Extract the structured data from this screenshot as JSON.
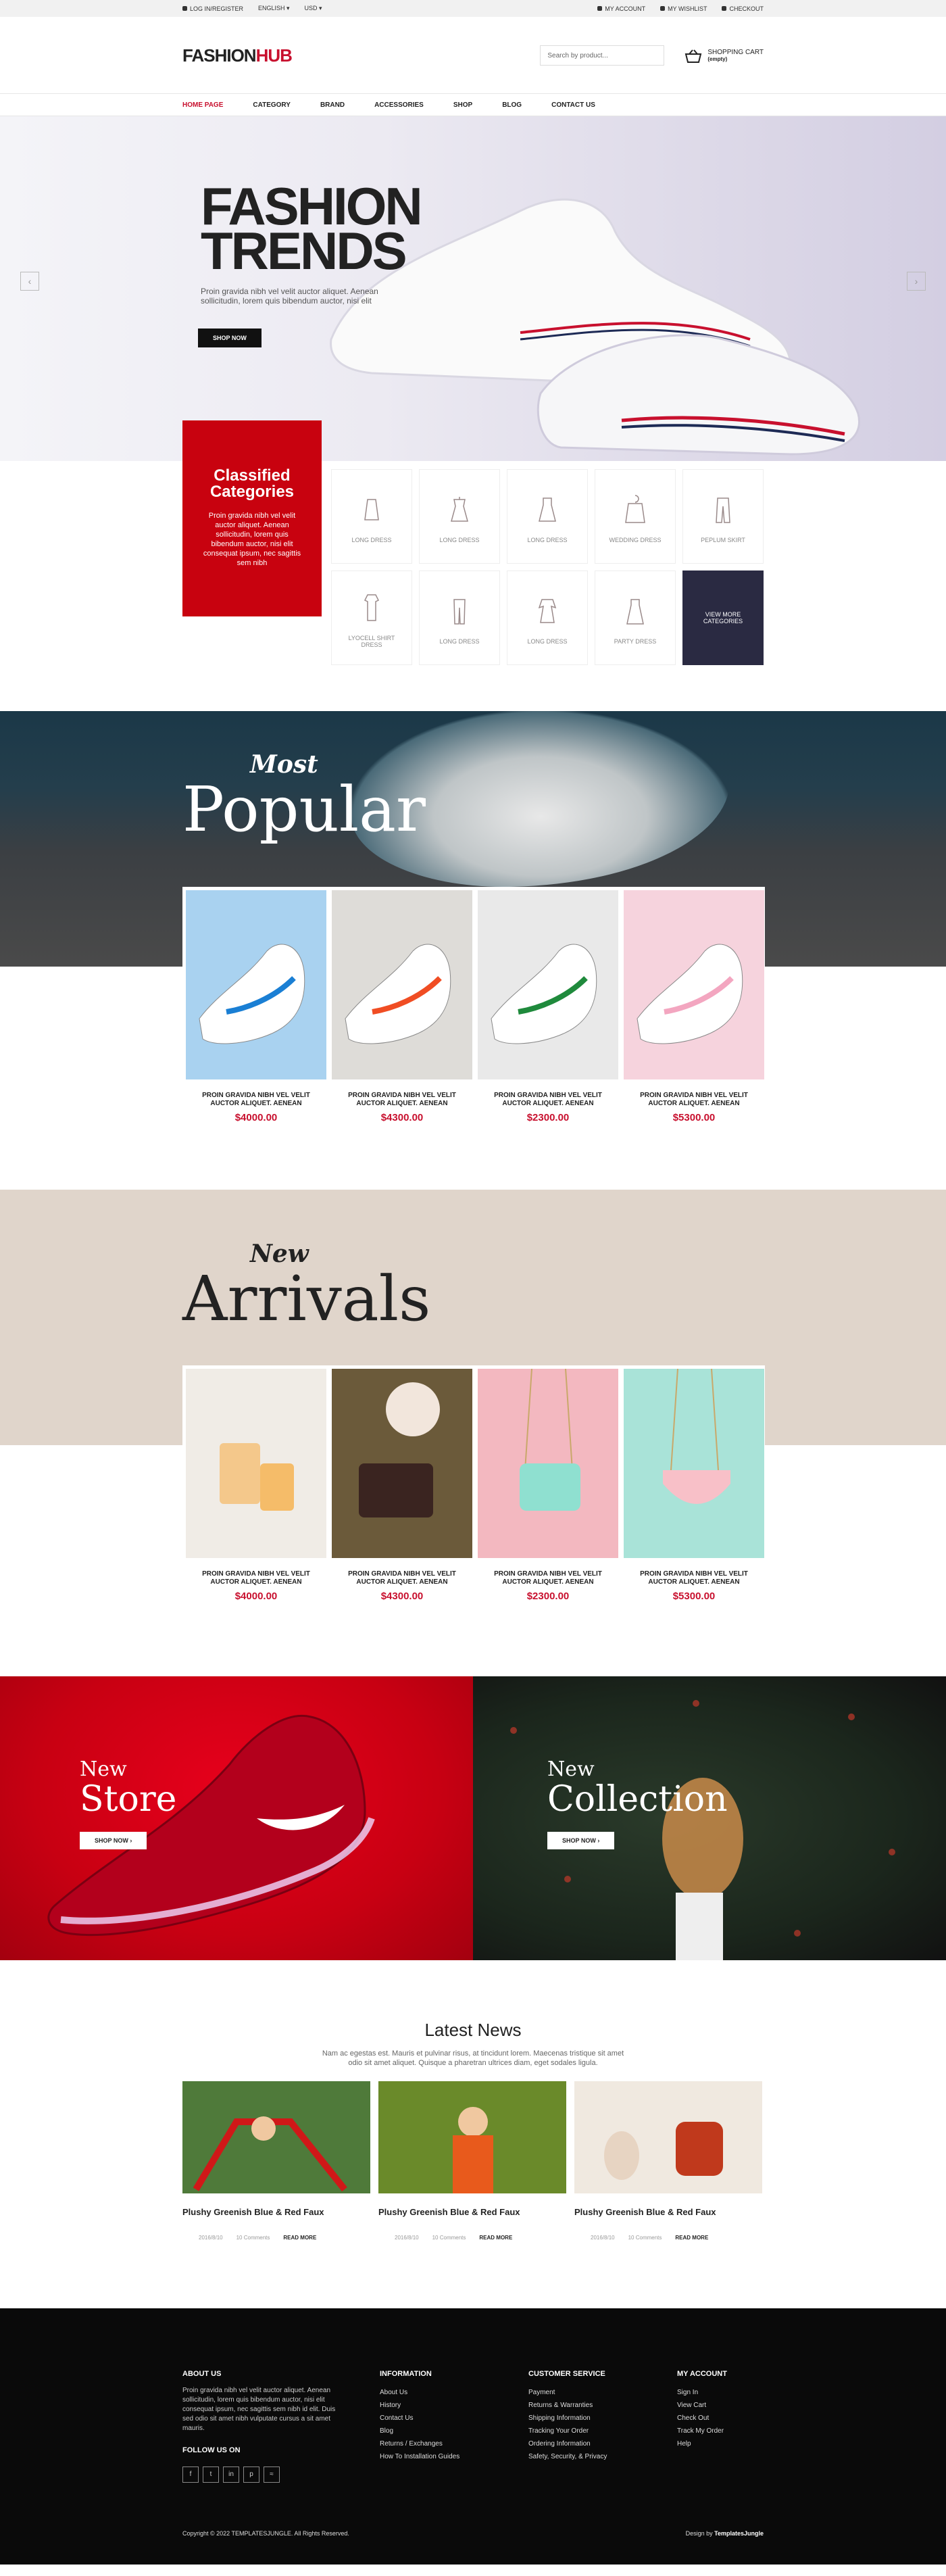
{
  "topbar": {
    "login": "LOG IN/REGISTER",
    "lang": "ENGLISH ▾",
    "currency": "USD ▾",
    "account": "MY ACCOUNT",
    "wishlist": "MY WISHLIST",
    "checkout": "CHECKOUT"
  },
  "header": {
    "logo_a": "FASHION",
    "logo_b": "HUB",
    "search_placeholder": "Search by product...",
    "cart_title": "SHOPPING CART",
    "cart_sub": "(empty)"
  },
  "nav": [
    "HOME PAGE",
    "CATEGORY",
    "BRAND",
    "ACCESSORIES",
    "SHOP",
    "BLOG",
    "CONTACT US"
  ],
  "hero": {
    "line1": "FASHION",
    "line2": "TRENDS",
    "text": "Proin gravida nibh vel velit auctor aliquet. Aenean sollicitudin, lorem quis bibendum auctor, nisi elit",
    "button": "SHOP NOW",
    "prev": "‹",
    "next": "›"
  },
  "categories": {
    "title": "Classified Categories",
    "text": "Proin gravida nibh vel velit auctor aliquet. Aenean sollicitudin, lorem quis bibendum auctor, nisi elit consequat ipsum, nec sagittis sem nibh",
    "items": [
      "LONG DRESS",
      "LONG DRESS",
      "LONG DRESS",
      "WEDDING DRESS",
      "PEPLUM SKIRT",
      "LYOCELL SHIRT DRESS",
      "LONG DRESS",
      "LONG DRESS",
      "PARTY DRESS",
      "VIEW MORE CATEGORIES"
    ]
  },
  "popular": {
    "small": "Most",
    "big": "Popular",
    "products": [
      {
        "name": "PROIN GRAVIDA NIBH VEL VELIT AUCTOR ALIQUET. AENEAN",
        "price": "$4000.00"
      },
      {
        "name": "PROIN GRAVIDA NIBH VEL VELIT AUCTOR ALIQUET. AENEAN",
        "price": "$4300.00"
      },
      {
        "name": "PROIN GRAVIDA NIBH VEL VELIT AUCTOR ALIQUET. AENEAN",
        "price": "$2300.00"
      },
      {
        "name": "PROIN GRAVIDA NIBH VEL VELIT AUCTOR ALIQUET. AENEAN",
        "price": "$5300.00"
      }
    ]
  },
  "arrivals": {
    "small": "New",
    "big": "Arrivals",
    "products": [
      {
        "name": "PROIN GRAVIDA NIBH VEL VELIT AUCTOR ALIQUET. AENEAN",
        "price": "$4000.00"
      },
      {
        "name": "PROIN GRAVIDA NIBH VEL VELIT AUCTOR ALIQUET. AENEAN",
        "price": "$4300.00"
      },
      {
        "name": "PROIN GRAVIDA NIBH VEL VELIT AUCTOR ALIQUET. AENEAN",
        "price": "$2300.00"
      },
      {
        "name": "PROIN GRAVIDA NIBH VEL VELIT AUCTOR ALIQUET. AENEAN",
        "price": "$5300.00"
      }
    ]
  },
  "promo": [
    {
      "a": "New",
      "b": "Store",
      "button": "SHOP NOW ›"
    },
    {
      "a": "New",
      "b": "Collection",
      "button": "SHOP NOW ›"
    }
  ],
  "news": {
    "title": "Latest News",
    "intro": "Nam ac egestas est. Mauris et pulvinar risus, at tincidunt lorem. Maecenas tristique sit amet odio sit amet aliquet. Quisque a pharetran ultrices diam, eget sodales ligula.",
    "items": [
      {
        "title": "Plushy Greenish Blue & Red Faux",
        "date": "2016/8/10",
        "comments": "10 Comments",
        "more": "READ MORE"
      },
      {
        "title": "Plushy Greenish Blue & Red Faux",
        "date": "2016/8/10",
        "comments": "10 Comments",
        "more": "READ MORE"
      },
      {
        "title": "Plushy Greenish Blue & Red Faux",
        "date": "2016/8/10",
        "comments": "10 Comments",
        "more": "READ MORE"
      }
    ]
  },
  "footer": {
    "about_title": "ABOUT US",
    "about_text": "Proin gravida nibh vel velit auctor aliquet. Aenean sollicitudin, lorem quis bibendum auctor, nisi elit consequat ipsum, nec sagittis sem nibh id elit. Duis sed odio sit amet nibh vulputate cursus a sit amet mauris.",
    "follow": "FOLLOW US ON",
    "info_title": "INFORMATION",
    "info": [
      "About Us",
      "History",
      "Contact Us",
      "Blog",
      "Returns / Exchanges",
      "How To Installation Guides"
    ],
    "cs_title": "CUSTOMER SERVICE",
    "cs": [
      "Payment",
      "Returns & Warranties",
      "Shipping Information",
      "Tracking Your Order",
      "Ordering Information",
      "Safety, Security, & Privacy"
    ],
    "acc_title": "MY ACCOUNT",
    "acc": [
      "Sign In",
      "View Cart",
      "Check Out",
      "Track My Order",
      "Help"
    ],
    "copyright": "Copyright © 2022 TEMPLATESJUNGLE. All Rights Reserved.",
    "design_pre": "Design by ",
    "design_by": "TemplatesJungle"
  },
  "colors": {
    "accent": "#c8102e",
    "category_box": "#c8020f",
    "dark_cell": "#2a2a42"
  }
}
